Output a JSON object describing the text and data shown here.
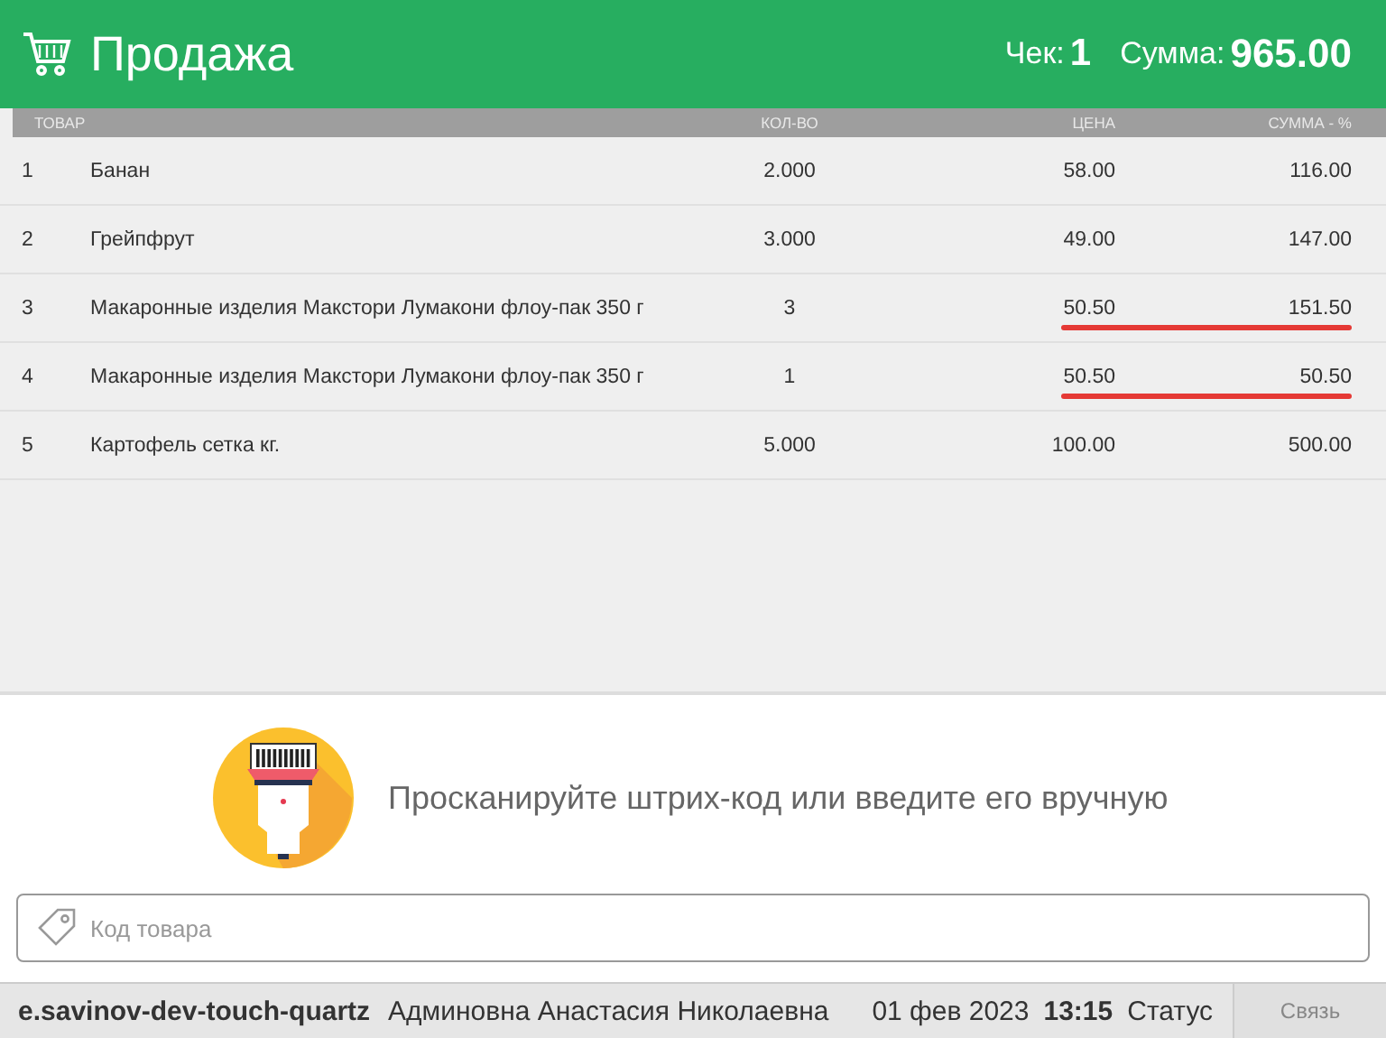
{
  "header": {
    "title": "Продажа",
    "receipt_label": "Чек:",
    "receipt_number": "1",
    "total_label": "Сумма:",
    "total_value": "965.00"
  },
  "table": {
    "columns": [
      "ТОВАР",
      "КОЛ-ВО",
      "ЦЕНА",
      "СУММА - %"
    ],
    "rows": [
      {
        "number": "1",
        "name": "Банан",
        "quantity": "2.000",
        "price": "58.00",
        "sum": "116.00",
        "underlined": false
      },
      {
        "number": "2",
        "name": "Грейпфрут",
        "quantity": "3.000",
        "price": "49.00",
        "sum": "147.00",
        "underlined": false
      },
      {
        "number": "3",
        "name": "Макаронные изделия Макстори Лумакони флоу-пак 350 г",
        "quantity": "3",
        "price": "50.50",
        "sum": "151.50",
        "underlined": true
      },
      {
        "number": "4",
        "name": "Макаронные изделия Макстори Лумакони флоу-пак 350 г",
        "quantity": "1",
        "price": "50.50",
        "sum": "50.50",
        "underlined": true
      },
      {
        "number": "5",
        "name": "Картофель сетка кг.",
        "quantity": "5.000",
        "price": "100.00",
        "sum": "500.00",
        "underlined": false
      }
    ]
  },
  "scan_prompt": "Просканируйте штрих-код или введите его вручную",
  "barcode_field": {
    "placeholder": "Код товара"
  },
  "status_bar": {
    "host": "e.savinov-dev-touch-quartz",
    "user": "Админовна Анастасия Николаевна",
    "date": "01 фев 2023",
    "time": "13:15",
    "status": "Статус",
    "connect_button": "Связь"
  }
}
